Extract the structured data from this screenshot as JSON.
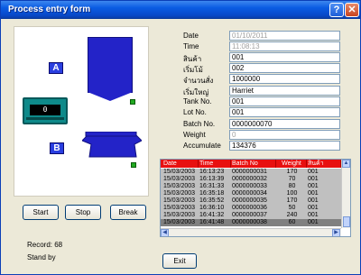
{
  "window": {
    "title": "Process entry form",
    "help_glyph": "?",
    "close_glyph": "✕"
  },
  "panel": {
    "tank_a": "A",
    "tank_b": "B",
    "scale_value": "0"
  },
  "buttons": {
    "start": "Start",
    "stop": "Stop",
    "break": "Break",
    "exit": "Exit"
  },
  "status": {
    "record": "Record: 68",
    "state": "Stand by"
  },
  "form": [
    {
      "label": "Date",
      "value": "01/10/2011",
      "disabled": true
    },
    {
      "label": "Time",
      "value": "11:08:13",
      "disabled": true
    },
    {
      "label": "สินค้า",
      "value": "001",
      "disabled": false
    },
    {
      "label": "เริ่มโม้",
      "value": "002",
      "disabled": false
    },
    {
      "label": "จำนวนสั่ง",
      "value": "1000000",
      "disabled": false
    },
    {
      "label": "เริ่มใหญ่",
      "value": "Harriet",
      "disabled": false
    },
    {
      "label": "Tank No.",
      "value": "001",
      "disabled": false
    },
    {
      "label": "Lot No.",
      "value": "001",
      "disabled": false
    },
    {
      "label": "Batch No.",
      "value": "0000000070",
      "disabled": false
    },
    {
      "label": "Weight",
      "value": "0",
      "disabled": true
    },
    {
      "label": "Accumulate",
      "value": "134376",
      "disabled": false
    }
  ],
  "grid": {
    "columns": [
      "Date",
      "Time",
      "Batch No",
      "Weight",
      "สินค้า"
    ],
    "rows": [
      [
        "15/03/2003",
        "16:13:23",
        "0000000031",
        "170",
        "001"
      ],
      [
        "15/03/2003",
        "16:13:39",
        "0000000032",
        "70",
        "001"
      ],
      [
        "15/03/2003",
        "16:31:33",
        "0000000033",
        "80",
        "001"
      ],
      [
        "15/03/2003",
        "16:35:18",
        "0000000034",
        "100",
        "001"
      ],
      [
        "15/03/2003",
        "16:35:52",
        "0000000035",
        "170",
        "001"
      ],
      [
        "15/03/2003",
        "16:36:10",
        "0000000036",
        "50",
        "001"
      ],
      [
        "15/03/2003",
        "16:41:32",
        "0000000037",
        "240",
        "001"
      ],
      [
        "15/03/2003",
        "16:41:48",
        "0000000038",
        "60",
        "001"
      ]
    ],
    "colors": {
      "header": "#e81010",
      "row": "#c0c0c0",
      "selected": "#808080"
    }
  }
}
